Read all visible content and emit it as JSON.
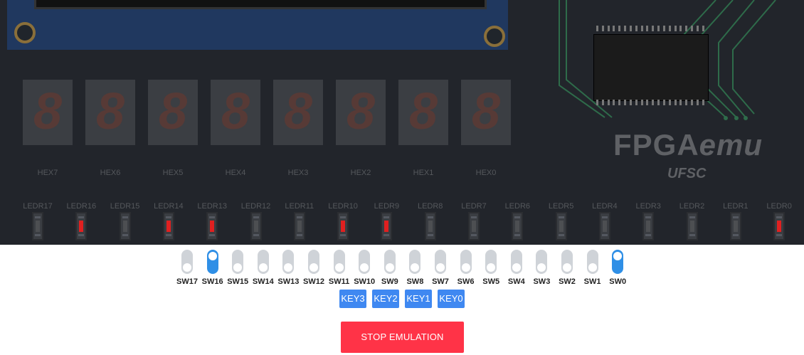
{
  "board": {
    "brand": "FPGA",
    "brand_italic": "emu",
    "brand_sub": "UFSC",
    "hex_displays": [
      "HEX7",
      "HEX6",
      "HEX5",
      "HEX4",
      "HEX3",
      "HEX2",
      "HEX1",
      "HEX0"
    ],
    "hex_digit": "8",
    "leds": [
      {
        "label": "LEDR17",
        "on": false
      },
      {
        "label": "LEDR16",
        "on": true
      },
      {
        "label": "LEDR15",
        "on": false
      },
      {
        "label": "LEDR14",
        "on": true
      },
      {
        "label": "LEDR13",
        "on": true
      },
      {
        "label": "LEDR12",
        "on": false
      },
      {
        "label": "LEDR11",
        "on": false
      },
      {
        "label": "LEDR10",
        "on": true
      },
      {
        "label": "LEDR9",
        "on": true
      },
      {
        "label": "LEDR8",
        "on": false
      },
      {
        "label": "LEDR7",
        "on": false
      },
      {
        "label": "LEDR6",
        "on": false
      },
      {
        "label": "LEDR5",
        "on": false
      },
      {
        "label": "LEDR4",
        "on": false
      },
      {
        "label": "LEDR3",
        "on": false
      },
      {
        "label": "LEDR2",
        "on": false
      },
      {
        "label": "LEDR1",
        "on": false
      },
      {
        "label": "LEDR0",
        "on": true
      }
    ]
  },
  "controls": {
    "switches": [
      {
        "label": "SW17",
        "on": false
      },
      {
        "label": "SW16",
        "on": true
      },
      {
        "label": "SW15",
        "on": false
      },
      {
        "label": "SW14",
        "on": false
      },
      {
        "label": "SW13",
        "on": false
      },
      {
        "label": "SW12",
        "on": false
      },
      {
        "label": "SW11",
        "on": false
      },
      {
        "label": "SW10",
        "on": false
      },
      {
        "label": "SW9",
        "on": false
      },
      {
        "label": "SW8",
        "on": false
      },
      {
        "label": "SW7",
        "on": false
      },
      {
        "label": "SW6",
        "on": false
      },
      {
        "label": "SW5",
        "on": false
      },
      {
        "label": "SW4",
        "on": false
      },
      {
        "label": "SW3",
        "on": false
      },
      {
        "label": "SW2",
        "on": false
      },
      {
        "label": "SW1",
        "on": false
      },
      {
        "label": "SW0",
        "on": true
      }
    ],
    "keys": [
      "KEY3",
      "KEY2",
      "KEY1",
      "KEY0"
    ],
    "stop_label": "STOP EMULATION"
  },
  "colors": {
    "board_bg": "#22252b",
    "led_on": "#e02020",
    "switch_on": "#2f8fe6",
    "key_bg": "#3f88f1",
    "stop_bg": "#ff3347"
  }
}
